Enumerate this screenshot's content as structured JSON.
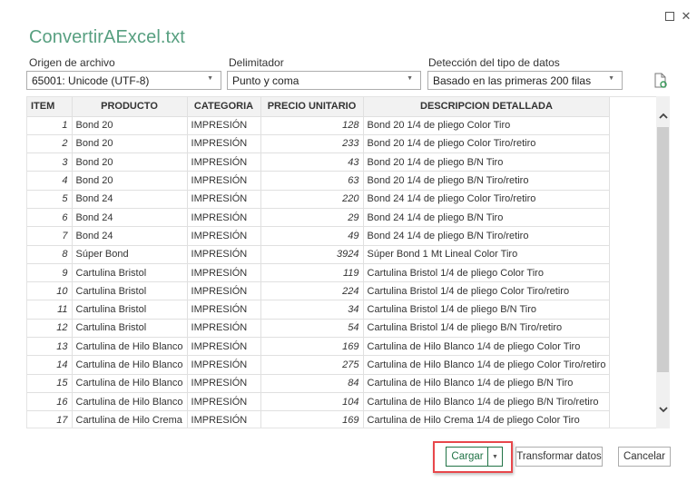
{
  "window": {
    "title": "ConvertirAExcel.txt",
    "maximize_icon": "□",
    "close_icon": "✕"
  },
  "options": {
    "file_origin": {
      "label": "Origen de archivo",
      "value": "65001: Unicode (UTF-8)"
    },
    "delimiter": {
      "label": "Delimitador",
      "value": "Punto y coma"
    },
    "type_detection": {
      "label": "Detección del tipo de datos",
      "value": "Basado en las primeras 200 filas"
    },
    "dropdown_arrow": "▼"
  },
  "table": {
    "columns": [
      "ITEM",
      "PRODUCTO",
      "CATEGORIA",
      "PRECIO UNITARIO",
      "DESCRIPCION DETALLADA"
    ],
    "rows": [
      [
        "1",
        "Bond 20",
        "IMPRESIÓN",
        "128",
        "Bond 20 1/4 de pliego Color Tiro"
      ],
      [
        "2",
        "Bond 20",
        "IMPRESIÓN",
        "233",
        "Bond 20 1/4 de pliego Color Tiro/retiro"
      ],
      [
        "3",
        "Bond 20",
        "IMPRESIÓN",
        "43",
        "Bond 20 1/4 de pliego B/N Tiro"
      ],
      [
        "4",
        "Bond 20",
        "IMPRESIÓN",
        "63",
        "Bond 20 1/4 de pliego B/N Tiro/retiro"
      ],
      [
        "5",
        "Bond 24",
        "IMPRESIÓN",
        "220",
        "Bond 24 1/4 de pliego Color Tiro/retiro"
      ],
      [
        "6",
        "Bond 24",
        "IMPRESIÓN",
        "29",
        "Bond 24 1/4 de pliego B/N Tiro"
      ],
      [
        "7",
        "Bond 24",
        "IMPRESIÓN",
        "49",
        "Bond 24 1/4 de pliego B/N Tiro/retiro"
      ],
      [
        "8",
        "Súper Bond",
        "IMPRESIÓN",
        "3924",
        "Súper Bond 1 Mt Lineal Color Tiro"
      ],
      [
        "9",
        "Cartulina Bristol",
        "IMPRESIÓN",
        "119",
        "Cartulina Bristol 1/4 de pliego Color Tiro"
      ],
      [
        "10",
        "Cartulina Bristol",
        "IMPRESIÓN",
        "224",
        "Cartulina Bristol 1/4 de pliego Color Tiro/retiro"
      ],
      [
        "11",
        "Cartulina Bristol",
        "IMPRESIÓN",
        "34",
        "Cartulina Bristol 1/4 de pliego B/N Tiro"
      ],
      [
        "12",
        "Cartulina Bristol",
        "IMPRESIÓN",
        "54",
        "Cartulina Bristol 1/4 de pliego B/N Tiro/retiro"
      ],
      [
        "13",
        "Cartulina de Hilo Blanco",
        "IMPRESIÓN",
        "169",
        "Cartulina de Hilo Blanco 1/4 de pliego Color Tiro"
      ],
      [
        "14",
        "Cartulina de Hilo Blanco",
        "IMPRESIÓN",
        "275",
        "Cartulina de Hilo Blanco 1/4 de pliego Color Tiro/retiro"
      ],
      [
        "15",
        "Cartulina de Hilo Blanco",
        "IMPRESIÓN",
        "84",
        "Cartulina de Hilo Blanco 1/4 de pliego B/N Tiro"
      ],
      [
        "16",
        "Cartulina de Hilo Blanco",
        "IMPRESIÓN",
        "104",
        "Cartulina de Hilo Blanco 1/4 de pliego B/N Tiro/retiro"
      ],
      [
        "17",
        "Cartulina de Hilo Crema",
        "IMPRESIÓN",
        "169",
        "Cartulina de Hilo Crema 1/4 de pliego Color Tiro"
      ]
    ]
  },
  "scrollbar": {
    "up_icon": "⌃",
    "down_icon": "⌄"
  },
  "footer": {
    "load_label": "Cargar",
    "load_dropdown_icon": "▼",
    "transform_label": "Transformar datos",
    "cancel_label": "Cancelar"
  },
  "colors": {
    "accent": "#217346",
    "highlight": "#e8474b"
  }
}
